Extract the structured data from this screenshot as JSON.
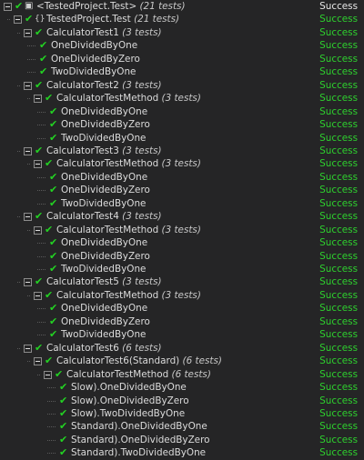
{
  "colors": {
    "background": "#252526",
    "success": "#2ed12e",
    "check": "#23d223",
    "text": "#dcdcdc"
  },
  "icons": {
    "expander": "minus-box-icon",
    "status": "check-icon",
    "root": "project-icon",
    "namespace": "namespace-icon"
  },
  "rows": [
    {
      "depth": 0,
      "expander": true,
      "icon": "project",
      "label": "<TestedProject.Test>",
      "count": "(21 tests)",
      "status": "Success",
      "root": true
    },
    {
      "depth": 1,
      "expander": true,
      "icon": "namespace",
      "label": "TestedProject.Test",
      "count": "(21 tests)",
      "status": "Success"
    },
    {
      "depth": 2,
      "expander": true,
      "label": "CalculatorTest1",
      "count": "(3 tests)",
      "status": "Success"
    },
    {
      "depth": 3,
      "expander": false,
      "label": "OneDividedByOne",
      "count": "",
      "status": "Success"
    },
    {
      "depth": 3,
      "expander": false,
      "label": "OneDividedByZero",
      "count": "",
      "status": "Success"
    },
    {
      "depth": 3,
      "expander": false,
      "label": "TwoDividedByOne",
      "count": "",
      "status": "Success"
    },
    {
      "depth": 2,
      "expander": true,
      "label": "CalculatorTest2",
      "count": "(3 tests)",
      "status": "Success"
    },
    {
      "depth": 3,
      "expander": true,
      "label": "CalculatorTestMethod",
      "count": "(3 tests)",
      "status": "Success"
    },
    {
      "depth": 4,
      "expander": false,
      "label": "OneDividedByOne",
      "count": "",
      "status": "Success"
    },
    {
      "depth": 4,
      "expander": false,
      "label": "OneDividedByZero",
      "count": "",
      "status": "Success"
    },
    {
      "depth": 4,
      "expander": false,
      "label": "TwoDividedByOne",
      "count": "",
      "status": "Success"
    },
    {
      "depth": 2,
      "expander": true,
      "label": "CalculatorTest3",
      "count": "(3 tests)",
      "status": "Success"
    },
    {
      "depth": 3,
      "expander": true,
      "label": "CalculatorTestMethod",
      "count": "(3 tests)",
      "status": "Success"
    },
    {
      "depth": 4,
      "expander": false,
      "label": "OneDividedByOne",
      "count": "",
      "status": "Success"
    },
    {
      "depth": 4,
      "expander": false,
      "label": "OneDividedByZero",
      "count": "",
      "status": "Success"
    },
    {
      "depth": 4,
      "expander": false,
      "label": "TwoDividedByOne",
      "count": "",
      "status": "Success"
    },
    {
      "depth": 2,
      "expander": true,
      "label": "CalculatorTest4",
      "count": "(3 tests)",
      "status": "Success"
    },
    {
      "depth": 3,
      "expander": true,
      "label": "CalculatorTestMethod",
      "count": "(3 tests)",
      "status": "Success"
    },
    {
      "depth": 4,
      "expander": false,
      "label": "OneDividedByOne",
      "count": "",
      "status": "Success"
    },
    {
      "depth": 4,
      "expander": false,
      "label": "OneDividedByZero",
      "count": "",
      "status": "Success"
    },
    {
      "depth": 4,
      "expander": false,
      "label": "TwoDividedByOne",
      "count": "",
      "status": "Success"
    },
    {
      "depth": 2,
      "expander": true,
      "label": "CalculatorTest5",
      "count": "(3 tests)",
      "status": "Success"
    },
    {
      "depth": 3,
      "expander": true,
      "label": "CalculatorTestMethod",
      "count": "(3 tests)",
      "status": "Success"
    },
    {
      "depth": 4,
      "expander": false,
      "label": "OneDividedByOne",
      "count": "",
      "status": "Success"
    },
    {
      "depth": 4,
      "expander": false,
      "label": "OneDividedByZero",
      "count": "",
      "status": "Success"
    },
    {
      "depth": 4,
      "expander": false,
      "label": "TwoDividedByOne",
      "count": "",
      "status": "Success"
    },
    {
      "depth": 2,
      "expander": true,
      "label": "CalculatorTest6",
      "count": "(6 tests)",
      "status": "Success"
    },
    {
      "depth": 3,
      "expander": true,
      "label": "CalculatorTest6(Standard)",
      "count": "(6 tests)",
      "status": "Success"
    },
    {
      "depth": 4,
      "expander": true,
      "label": "CalculatorTestMethod",
      "count": "(6 tests)",
      "status": "Success"
    },
    {
      "depth": 5,
      "expander": false,
      "label": "Slow).OneDividedByOne",
      "count": "",
      "status": "Success"
    },
    {
      "depth": 5,
      "expander": false,
      "label": "Slow).OneDividedByZero",
      "count": "",
      "status": "Success"
    },
    {
      "depth": 5,
      "expander": false,
      "label": "Slow).TwoDividedByOne",
      "count": "",
      "status": "Success"
    },
    {
      "depth": 5,
      "expander": false,
      "label": "Standard).OneDividedByOne",
      "count": "",
      "status": "Success"
    },
    {
      "depth": 5,
      "expander": false,
      "label": "Standard).OneDividedByZero",
      "count": "",
      "status": "Success"
    },
    {
      "depth": 5,
      "expander": false,
      "label": "Standard).TwoDividedByOne",
      "count": "",
      "status": "Success"
    }
  ]
}
